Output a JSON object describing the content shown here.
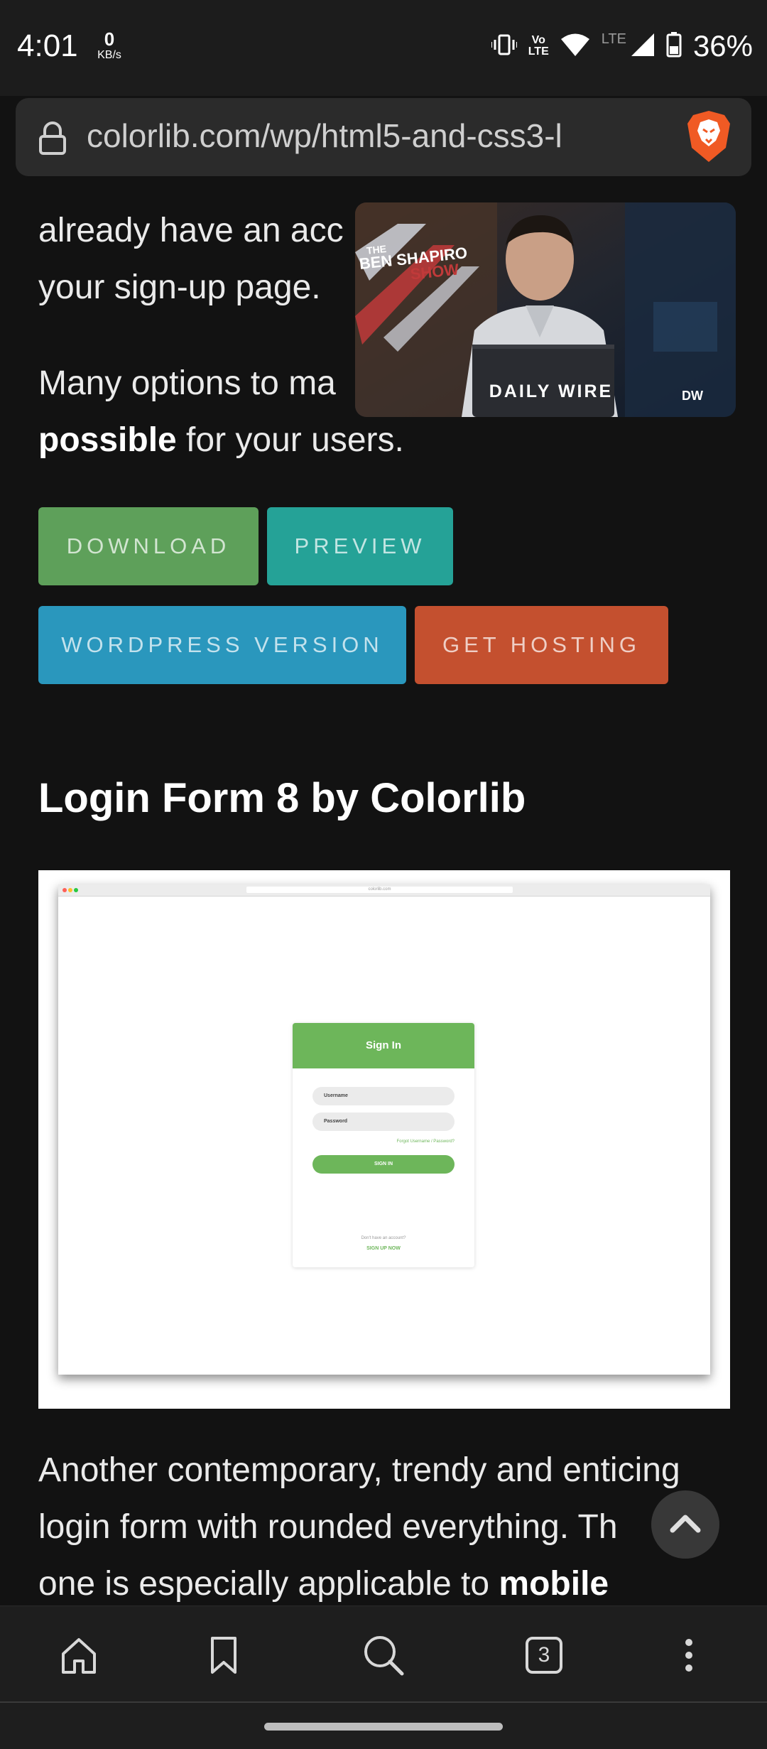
{
  "status_bar": {
    "time": "4:01",
    "net_speed_value": "0",
    "net_speed_unit": "KB/s",
    "volte_line1": "Vo",
    "volte_line2": "LTE",
    "lte_label": "LTE",
    "battery": "36%"
  },
  "browser": {
    "url": "colorlib.com/wp/html5-and-css3-l"
  },
  "article": {
    "para1_line1": "already have an acc",
    "para1_line2": "your sign-up page.",
    "para2_line1": "Many options to ma",
    "para2_bold": "possible",
    "para2_rest": " for your users.",
    "buttons": {
      "download": "DOWNLOAD",
      "preview": "PREVIEW",
      "wordpress": "WORDPRESS VERSION",
      "hosting": "GET HOSTING"
    },
    "heading": "Login Form 8 by Colorlib",
    "para3_line1": "Another contemporary, trendy and enticing",
    "para3_line2": "login form with rounded everything. Th",
    "para3_line3_start": "one is especially applicable to ",
    "para3_line3_bold": "mobile"
  },
  "screenshot_preview": {
    "mini_url": "colorlib.com",
    "title": "Sign In",
    "username_placeholder": "Username",
    "password_placeholder": "Password",
    "forgot": "Forgot Username / Password?",
    "signin_button": "SIGN IN",
    "no_account": "Don't have an account?",
    "signup": "SIGN UP NOW"
  },
  "video": {
    "show_line1": "THE",
    "show_line2": "BEN SHAPIRO",
    "show_line3": "SHOW",
    "brand": "DAILY WIRE",
    "corner_logo": "DW"
  },
  "colors": {
    "download": "#5ea05a",
    "preview": "#25a297",
    "wordpress": "#2a97bd",
    "hosting": "#c4502f",
    "page_bg": "#121212"
  },
  "bottom_nav": {
    "tab_count": "3"
  }
}
